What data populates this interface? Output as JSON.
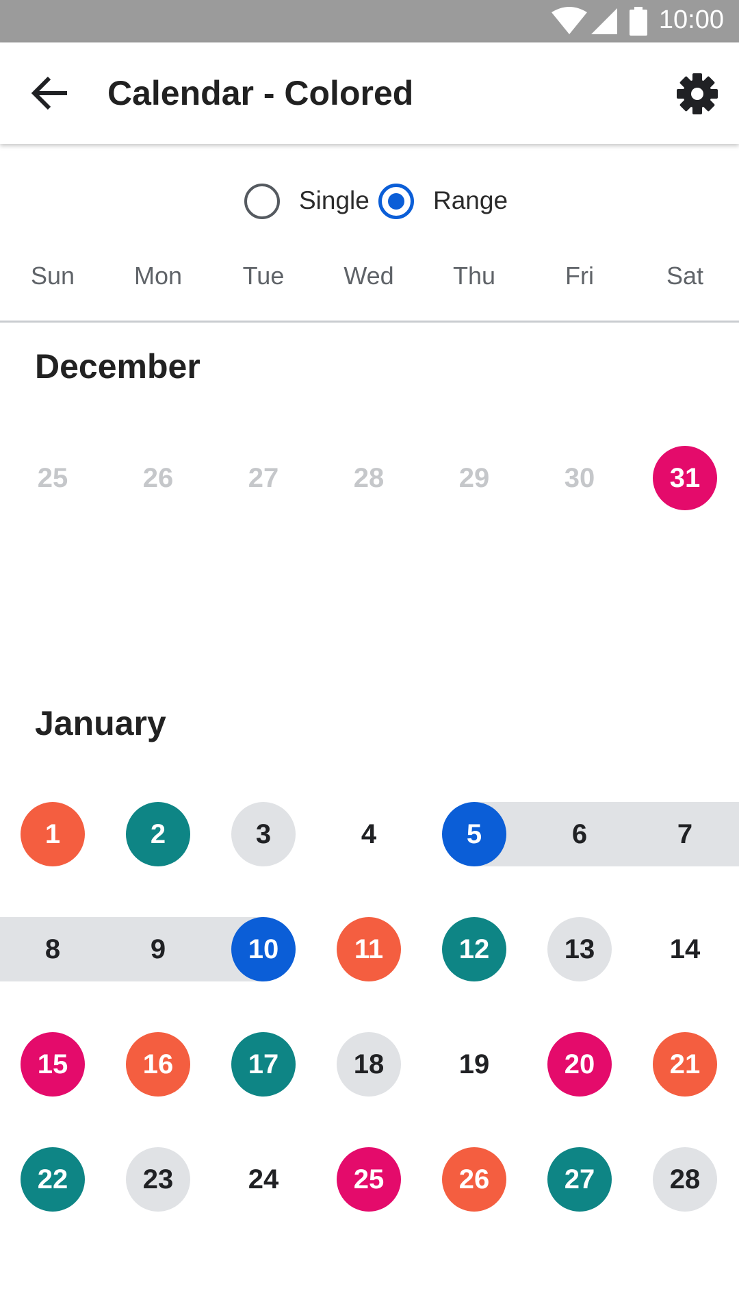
{
  "status_bar": {
    "time": "10:00",
    "icons": [
      "wifi-icon",
      "signal-icon",
      "battery-icon"
    ]
  },
  "app_bar": {
    "title": "Calendar - Colored",
    "back_icon": "arrow-back-icon",
    "settings_icon": "gear-icon"
  },
  "mode": {
    "options": [
      {
        "label": "Single",
        "selected": false
      },
      {
        "label": "Range",
        "selected": true
      }
    ]
  },
  "weekdays": [
    "Sun",
    "Mon",
    "Tue",
    "Wed",
    "Thu",
    "Fri",
    "Sat"
  ],
  "colors": {
    "magenta": "#e40b6b",
    "orange": "#f45e40",
    "teal": "#0e8585",
    "gray": "#e0e2e5",
    "blue": "#0b5ed7",
    "range_band": "#e0e2e5"
  },
  "months": [
    {
      "name": "December",
      "weeks": [
        [
          {
            "day": "25",
            "style": "faded"
          },
          {
            "day": "26",
            "style": "faded"
          },
          {
            "day": "27",
            "style": "faded"
          },
          {
            "day": "28",
            "style": "faded"
          },
          {
            "day": "29",
            "style": "faded"
          },
          {
            "day": "30",
            "style": "faded"
          },
          {
            "day": "31",
            "style": "magenta"
          }
        ]
      ]
    },
    {
      "name": "January",
      "weeks": [
        [
          {
            "day": "1",
            "style": "orange"
          },
          {
            "day": "2",
            "style": "teal"
          },
          {
            "day": "3",
            "style": "gray"
          },
          {
            "day": "4",
            "style": "plain"
          },
          {
            "day": "5",
            "style": "blue",
            "range": "start"
          },
          {
            "day": "6",
            "style": "plain",
            "range": "in"
          },
          {
            "day": "7",
            "style": "plain",
            "range": "in"
          }
        ],
        [
          {
            "day": "8",
            "style": "plain",
            "range": "in"
          },
          {
            "day": "9",
            "style": "plain",
            "range": "in"
          },
          {
            "day": "10",
            "style": "blue",
            "range": "end"
          },
          {
            "day": "11",
            "style": "orange"
          },
          {
            "day": "12",
            "style": "teal"
          },
          {
            "day": "13",
            "style": "gray"
          },
          {
            "day": "14",
            "style": "plain"
          }
        ],
        [
          {
            "day": "15",
            "style": "magenta"
          },
          {
            "day": "16",
            "style": "orange"
          },
          {
            "day": "17",
            "style": "teal"
          },
          {
            "day": "18",
            "style": "gray"
          },
          {
            "day": "19",
            "style": "plain"
          },
          {
            "day": "20",
            "style": "magenta"
          },
          {
            "day": "21",
            "style": "orange"
          }
        ],
        [
          {
            "day": "22",
            "style": "teal"
          },
          {
            "day": "23",
            "style": "gray"
          },
          {
            "day": "24",
            "style": "plain"
          },
          {
            "day": "25",
            "style": "magenta"
          },
          {
            "day": "26",
            "style": "orange"
          },
          {
            "day": "27",
            "style": "teal"
          },
          {
            "day": "28",
            "style": "gray"
          }
        ]
      ]
    }
  ]
}
